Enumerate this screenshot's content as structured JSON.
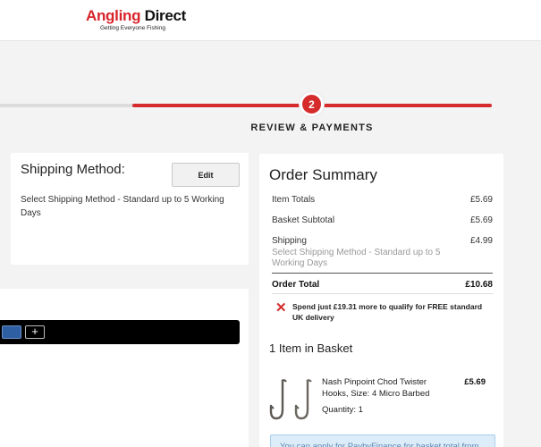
{
  "header": {
    "logo_word1": "Angling",
    "logo_word2": "Direct",
    "logo_tagline": "Getting Everyone Fishing"
  },
  "progress": {
    "step_number": "2",
    "step_label": "REVIEW & PAYMENTS"
  },
  "shipping": {
    "title": "Shipping Method:",
    "edit_label": "Edit",
    "text": "Select Shipping Method - Standard up to 5 Working Days"
  },
  "payment": {
    "add_label": "+"
  },
  "summary": {
    "title": "Order Summary",
    "item_totals_label": "Item Totals",
    "item_totals_value": "£5.69",
    "basket_subtotal_label": "Basket Subtotal",
    "basket_subtotal_value": "£5.69",
    "shipping_label": "Shipping",
    "shipping_value": "£4.99",
    "shipping_method": "Select Shipping Method - Standard up to 5 Working Days",
    "order_total_label": "Order Total",
    "order_total_value": "£10.68",
    "free_delivery_msg": "Spend just £19.31 more to qualify for FREE standard UK delivery",
    "basket_count": "1 Item in Basket",
    "product": {
      "name": "Nash Pinpoint Chod Twister Hooks, Size: 4 Micro Barbed",
      "price": "£5.69",
      "quantity": "Quantity: 1"
    },
    "finance_text": "You can apply for PaybyFinance for basket total from"
  },
  "colors": {
    "brand_red": "#d52b2b",
    "background": "#f3f3f3",
    "finance_bg": "#dcecf8"
  }
}
